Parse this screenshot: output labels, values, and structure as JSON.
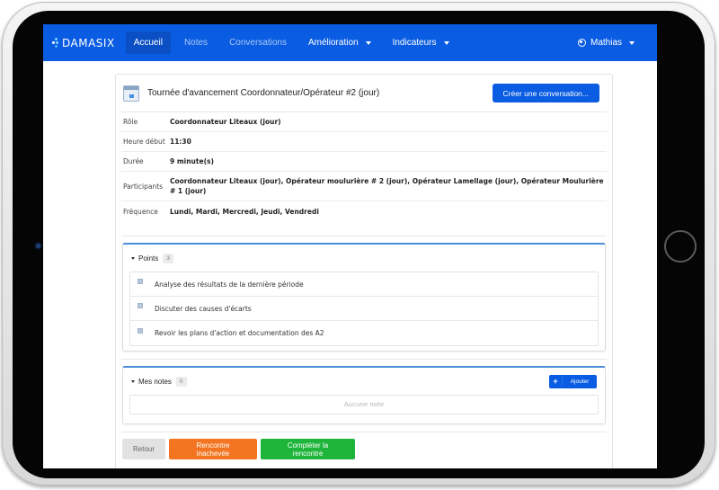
{
  "navbar": {
    "brand": "DAMASIX",
    "items": [
      {
        "label": "Accueil",
        "active": true
      },
      {
        "label": "Notes",
        "active": false
      },
      {
        "label": "Conversations",
        "active": false
      },
      {
        "label": "Amélioration",
        "dropdown": true
      },
      {
        "label": "Indicateurs",
        "dropdown": true
      }
    ],
    "user": "Mathias"
  },
  "meeting": {
    "title": "Tournée d'avancement Coordonnateur/Opérateur #2 (jour)",
    "create_conversation_label": "Créer une conversation...",
    "fields": [
      {
        "label": "Rôle",
        "value": "Coordonnateur Liteaux (jour)"
      },
      {
        "label": "Heure début",
        "value": "11:30"
      },
      {
        "label": "Durée",
        "value": "9 minute(s)"
      },
      {
        "label": "Participants",
        "value": "Coordonnateur Liteaux (jour), Opérateur moulurière # 2 (jour), Opérateur Lamellage (jour), Opérateur Moulurière # 1 (jour)"
      },
      {
        "label": "Fréquence",
        "value": "Lundi, Mardi, Mercredi, Jeudi, Vendredi"
      }
    ]
  },
  "points": {
    "title": "Points",
    "count": "3",
    "items": [
      "Analyse des résultats de la dernière période",
      "Discuter des causes d'écarts",
      "Revoir les plans d'action et documentation des A2"
    ]
  },
  "notes": {
    "title": "Mes notes",
    "count": "0",
    "add_label": "Ajouter",
    "empty_text": "Aucune note"
  },
  "actions": {
    "back": "Retour",
    "incomplete": "Rencontre inachevée",
    "complete": "Compléter la rencontre"
  },
  "colors": {
    "primary": "#0a5ce3",
    "orange": "#f37521",
    "green": "#1eb53a"
  }
}
